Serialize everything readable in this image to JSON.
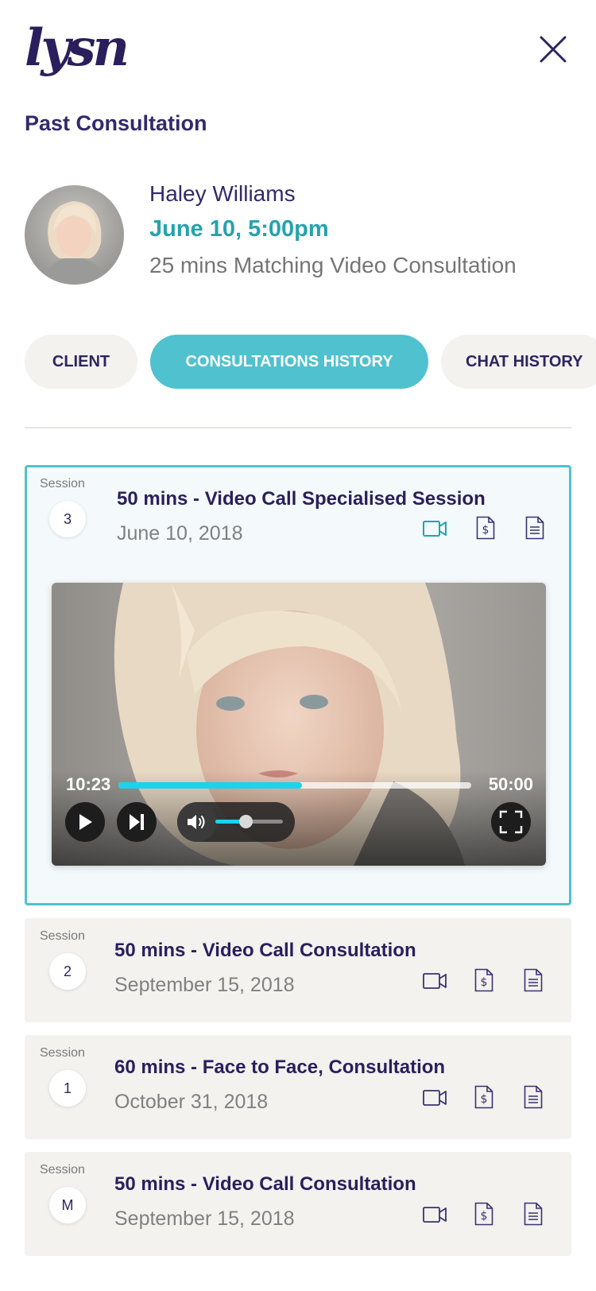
{
  "brand": {
    "logo_text": "lysn"
  },
  "header": {
    "title": "Past Consultation"
  },
  "client": {
    "name": "Haley Williams",
    "date": "June 10, 5:00pm",
    "consultation": "25 mins Matching Video Consultation"
  },
  "tabs": [
    {
      "label": "CLIENT",
      "active": false
    },
    {
      "label": "CONSULTATIONS HISTORY",
      "active": true
    },
    {
      "label": "CHAT HISTORY",
      "active": false
    }
  ],
  "sessions": [
    {
      "label": "Session",
      "number": "3",
      "title": "50 mins - Video Call Specialised Session",
      "date": "June 10, 2018",
      "expanded": true
    },
    {
      "label": "Session",
      "number": "2",
      "title": "50 mins - Video Call Consultation",
      "date": "September 15, 2018",
      "expanded": false
    },
    {
      "label": "Session",
      "number": "1",
      "title": "60 mins - Face to Face, Consultation",
      "date": "October 31, 2018",
      "expanded": false
    },
    {
      "label": "Session",
      "number": "M",
      "title": "50 mins - Video Call Consultation",
      "date": "September 15, 2018",
      "expanded": false
    }
  ],
  "player": {
    "current_time": "10:23",
    "total_time": "50:00",
    "progress_fraction": 0.52,
    "volume_fraction": 0.45
  },
  "colors": {
    "brand_navy": "#2a1f5c",
    "accent_teal": "#4fc1cf",
    "date_teal": "#25a3ad",
    "progress_cyan": "#19d3ef"
  },
  "icons": {
    "close": "close-icon",
    "video": "video-camera-icon",
    "invoice": "invoice-dollar-icon",
    "notes": "document-notes-icon",
    "play": "play-icon",
    "skip": "skip-next-icon",
    "volume": "volume-icon",
    "fullscreen": "fullscreen-icon"
  }
}
